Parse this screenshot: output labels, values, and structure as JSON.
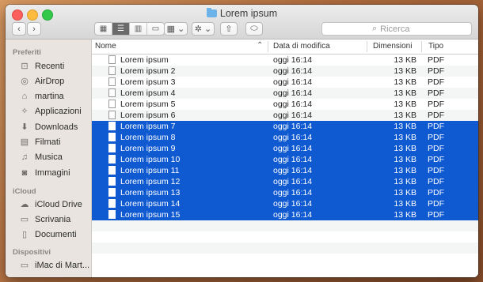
{
  "window": {
    "title": "Lorem ipsum",
    "search_placeholder": "Ricerca",
    "nav_back": "‹",
    "nav_forward": "›",
    "view_icons": [
      "▦",
      "☰",
      "▥",
      "▭"
    ],
    "arrange_icon": "▦ ⌄",
    "action_icon": "✲ ⌄",
    "share_icon": "⇧",
    "tag_icon": "⬭"
  },
  "sidebar": {
    "sections": [
      {
        "label": "Preferiti"
      },
      {
        "label": "iCloud"
      },
      {
        "label": "Dispositivi"
      }
    ],
    "favorites": [
      {
        "label": "Recenti",
        "icon": "⊡"
      },
      {
        "label": "AirDrop",
        "icon": "◎"
      },
      {
        "label": "martina",
        "icon": "⌂"
      },
      {
        "label": "Applicazioni",
        "icon": "✧"
      },
      {
        "label": "Downloads",
        "icon": "⬇"
      },
      {
        "label": "Filmati",
        "icon": "▤"
      },
      {
        "label": "Musica",
        "icon": "♫"
      },
      {
        "label": "Immagini",
        "icon": "◙"
      }
    ],
    "icloud": [
      {
        "label": "iCloud Drive",
        "icon": "☁"
      },
      {
        "label": "Scrivania",
        "icon": "▭"
      },
      {
        "label": "Documenti",
        "icon": "▯"
      }
    ],
    "devices": [
      {
        "label": "iMac di Mart...",
        "icon": "▭"
      }
    ]
  },
  "columns": {
    "name": "Nome",
    "date": "Data di modifica",
    "size": "Dimensioni",
    "kind": "Tipo",
    "sort_arrow": "⌃"
  },
  "files": [
    {
      "name": "Lorem ipsum",
      "date": "oggi 16:14",
      "size": "13 KB",
      "kind": "PDF"
    },
    {
      "name": "Lorem ipsum 2",
      "date": "oggi 16:14",
      "size": "13 KB",
      "kind": "PDF"
    },
    {
      "name": "Lorem ipsum 3",
      "date": "oggi 16:14",
      "size": "13 KB",
      "kind": "PDF"
    },
    {
      "name": "Lorem ipsum 4",
      "date": "oggi 16:14",
      "size": "13 KB",
      "kind": "PDF"
    },
    {
      "name": "Lorem ipsum 5",
      "date": "oggi 16:14",
      "size": "13 KB",
      "kind": "PDF"
    },
    {
      "name": "Lorem ipsum 6",
      "date": "oggi 16:14",
      "size": "13 KB",
      "kind": "PDF"
    },
    {
      "name": "Lorem ipsum 7",
      "date": "oggi 16:14",
      "size": "13 KB",
      "kind": "PDF"
    },
    {
      "name": "Lorem ipsum 8",
      "date": "oggi 16:14",
      "size": "13 KB",
      "kind": "PDF"
    },
    {
      "name": "Lorem ipsum 9",
      "date": "oggi 16:14",
      "size": "13 KB",
      "kind": "PDF"
    },
    {
      "name": "Lorem ipsum 10",
      "date": "oggi 16:14",
      "size": "13 KB",
      "kind": "PDF"
    },
    {
      "name": "Lorem ipsum 11",
      "date": "oggi 16:14",
      "size": "13 KB",
      "kind": "PDF"
    },
    {
      "name": "Lorem ipsum 12",
      "date": "oggi 16:14",
      "size": "13 KB",
      "kind": "PDF"
    },
    {
      "name": "Lorem ipsum 13",
      "date": "oggi 16:14",
      "size": "13 KB",
      "kind": "PDF"
    },
    {
      "name": "Lorem ipsum 14",
      "date": "oggi 16:14",
      "size": "13 KB",
      "kind": "PDF"
    },
    {
      "name": "Lorem ipsum 15",
      "date": "oggi 16:14",
      "size": "13 KB",
      "kind": "PDF"
    }
  ],
  "selected_from_index": 6,
  "colors": {
    "selection": "#0f59d1",
    "folder": "#6bb3e8"
  }
}
